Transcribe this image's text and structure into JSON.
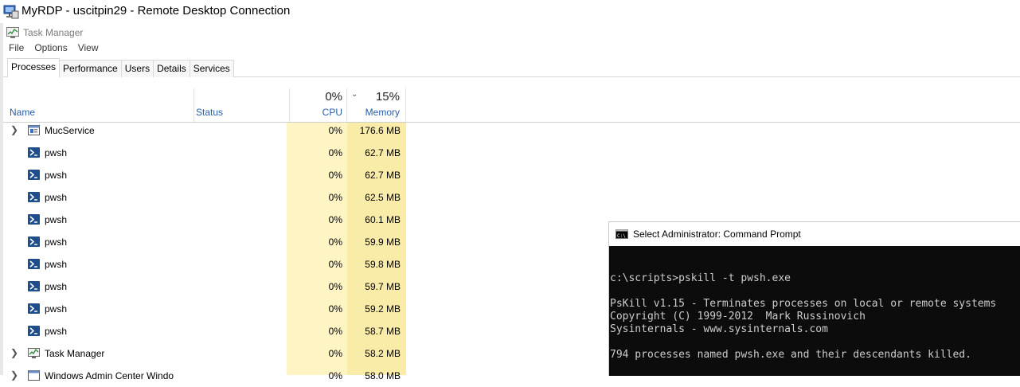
{
  "rdp": {
    "title": "MyRDP - uscitpin29 - Remote Desktop Connection"
  },
  "taskmanager": {
    "title": "Task Manager",
    "menu": [
      "File",
      "Options",
      "View"
    ],
    "tabs": [
      "Processes",
      "Performance",
      "Users",
      "Details",
      "Services"
    ],
    "active_tab": "Processes",
    "columns": {
      "name": "Name",
      "status": "Status",
      "cpu_label": "CPU",
      "cpu_total": "0%",
      "memory_label": "Memory",
      "memory_total": "15%"
    },
    "processes": [
      {
        "name": "MucService",
        "cpu": "0%",
        "memory": "176.6 MB",
        "expandable": true,
        "icon": "service-icon"
      },
      {
        "name": "pwsh",
        "cpu": "0%",
        "memory": "62.7 MB",
        "expandable": false,
        "icon": "powershell-icon"
      },
      {
        "name": "pwsh",
        "cpu": "0%",
        "memory": "62.7 MB",
        "expandable": false,
        "icon": "powershell-icon"
      },
      {
        "name": "pwsh",
        "cpu": "0%",
        "memory": "62.5 MB",
        "expandable": false,
        "icon": "powershell-icon"
      },
      {
        "name": "pwsh",
        "cpu": "0%",
        "memory": "60.1 MB",
        "expandable": false,
        "icon": "powershell-icon"
      },
      {
        "name": "pwsh",
        "cpu": "0%",
        "memory": "59.9 MB",
        "expandable": false,
        "icon": "powershell-icon"
      },
      {
        "name": "pwsh",
        "cpu": "0%",
        "memory": "59.8 MB",
        "expandable": false,
        "icon": "powershell-icon"
      },
      {
        "name": "pwsh",
        "cpu": "0%",
        "memory": "59.7 MB",
        "expandable": false,
        "icon": "powershell-icon"
      },
      {
        "name": "pwsh",
        "cpu": "0%",
        "memory": "59.2 MB",
        "expandable": false,
        "icon": "powershell-icon"
      },
      {
        "name": "pwsh",
        "cpu": "0%",
        "memory": "58.7 MB",
        "expandable": false,
        "icon": "powershell-icon"
      },
      {
        "name": "Task Manager",
        "cpu": "0%",
        "memory": "58.2 MB",
        "expandable": true,
        "icon": "taskmanager-icon"
      },
      {
        "name": "Windows Admin Center Windo",
        "cpu": "0%",
        "memory": "58.0 MB",
        "expandable": true,
        "icon": "window-icon"
      }
    ]
  },
  "cmd": {
    "title": "Select Administrator: Command Prompt",
    "lines": [
      "c:\\scripts>pskill -t pwsh.exe",
      "",
      "PsKill v1.15 - Terminates processes on local or remote systems",
      "Copyright (C) 1999-2012  Mark Russinovich",
      "Sysinternals - www.sysinternals.com",
      "",
      "794 processes named pwsh.exe and their descendants killed."
    ]
  },
  "colors": {
    "cpu_column": "#fff4c4",
    "memory_column": "#f9eca8",
    "header_text": "#2a5ea8",
    "console_bg": "#0c0c0c",
    "console_text": "#cccccc"
  }
}
